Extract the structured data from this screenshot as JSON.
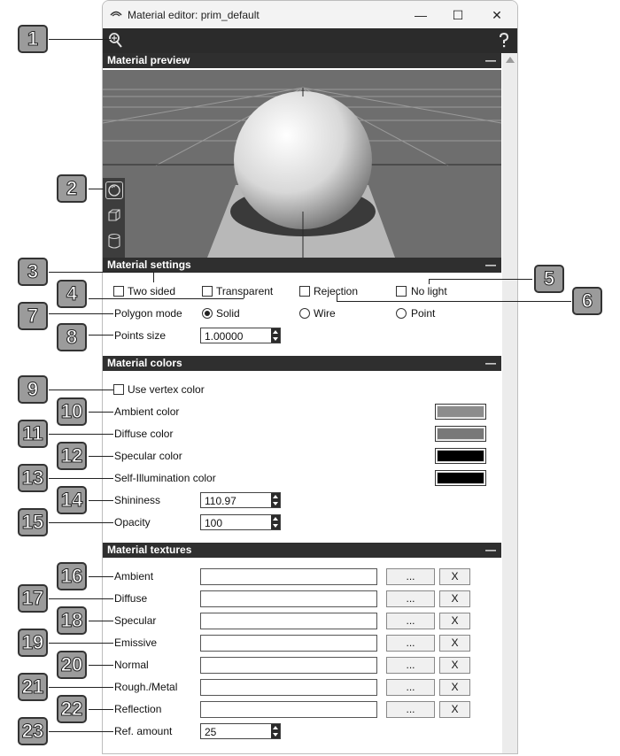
{
  "window": {
    "title": "Material editor: prim_default",
    "minimize": "—",
    "maximize": "☐",
    "close": "✕"
  },
  "toolbar": {
    "tool_icon": "wand-icon",
    "help_icon": "help-icon"
  },
  "sections": {
    "preview": "Material preview",
    "settings": "Material settings",
    "colors": "Material colors",
    "textures": "Material textures",
    "collapse": "—"
  },
  "preview_tools": [
    "sphere-icon",
    "cube-icon",
    "cylinder-icon"
  ],
  "settings": {
    "two_sided": "Two sided",
    "transparent": "Transparent",
    "rejection": "Rejection",
    "no_light": "No light",
    "polygon_mode_label": "Polygon mode",
    "polygon_modes": [
      "Solid",
      "Wire",
      "Point"
    ],
    "polygon_mode_selected": "Solid",
    "points_size_label": "Points size",
    "points_size": "1.00000"
  },
  "colors": {
    "use_vertex_color": "Use vertex color",
    "ambient": {
      "label": "Ambient color",
      "color": "#8c8c8c"
    },
    "diffuse": {
      "label": "Diffuse color",
      "color": "#787878"
    },
    "specular": {
      "label": "Specular color",
      "color": "#000000"
    },
    "self_illum": {
      "label": "Self-Illumination color",
      "color": "#000000"
    },
    "shininess_label": "Shininess",
    "shininess": "110.97",
    "opacity_label": "Opacity",
    "opacity": "100"
  },
  "textures": {
    "rows": [
      {
        "label": "Ambient"
      },
      {
        "label": "Diffuse"
      },
      {
        "label": "Specular"
      },
      {
        "label": "Emissive"
      },
      {
        "label": "Normal"
      },
      {
        "label": "Rough./Metal"
      },
      {
        "label": "Reflection"
      }
    ],
    "browse": "...",
    "clear": "X",
    "ref_amount_label": "Ref. amount",
    "ref_amount": "25"
  },
  "callouts": [
    "1",
    "2",
    "3",
    "4",
    "5",
    "6",
    "7",
    "8",
    "9",
    "10",
    "11",
    "12",
    "13",
    "14",
    "15",
    "16",
    "17",
    "18",
    "19",
    "20",
    "21",
    "22",
    "23"
  ]
}
